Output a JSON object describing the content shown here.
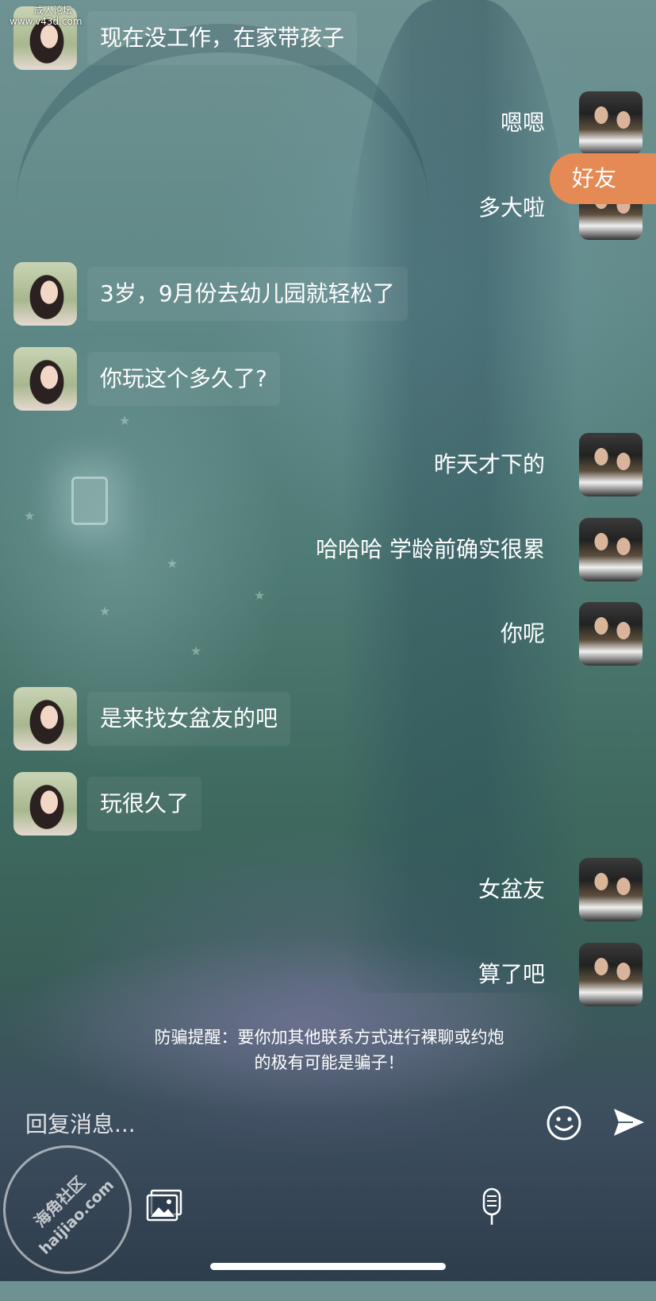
{
  "watermark": {
    "forum_label": "成人论坛",
    "site_url": "www.v43d.com",
    "stamp_cn": "海角社区",
    "stamp_en": "haijiao.com"
  },
  "friend_tag": "好友",
  "messages": [
    {
      "side": "her",
      "text": "现在没工作，在家带孩子"
    },
    {
      "side": "me",
      "text": "嗯嗯"
    },
    {
      "side": "me",
      "text": "多大啦"
    },
    {
      "side": "her",
      "text": "3岁，9月份去幼儿园就轻松了"
    },
    {
      "side": "her",
      "text": "你玩这个多久了?"
    },
    {
      "side": "me",
      "text": "昨天才下的"
    },
    {
      "side": "me",
      "text": "哈哈哈 学龄前确实很累"
    },
    {
      "side": "me",
      "text": "你呢"
    },
    {
      "side": "her",
      "text": "是来找女盆友的吧"
    },
    {
      "side": "her",
      "text": "玩很久了"
    },
    {
      "side": "me",
      "text": "女盆友"
    },
    {
      "side": "me",
      "text": "算了吧"
    }
  ],
  "warning": {
    "line1": "防骗提醒：要你加其他联系方式进行裸聊或约炮",
    "line2": "的极有可能是骗子！"
  },
  "composer": {
    "placeholder": "回复消息...",
    "emoji_icon": "emoji-icon",
    "send_icon": "send-icon",
    "image_icon": "image-icon",
    "voice_icon": "microphone-icon"
  }
}
